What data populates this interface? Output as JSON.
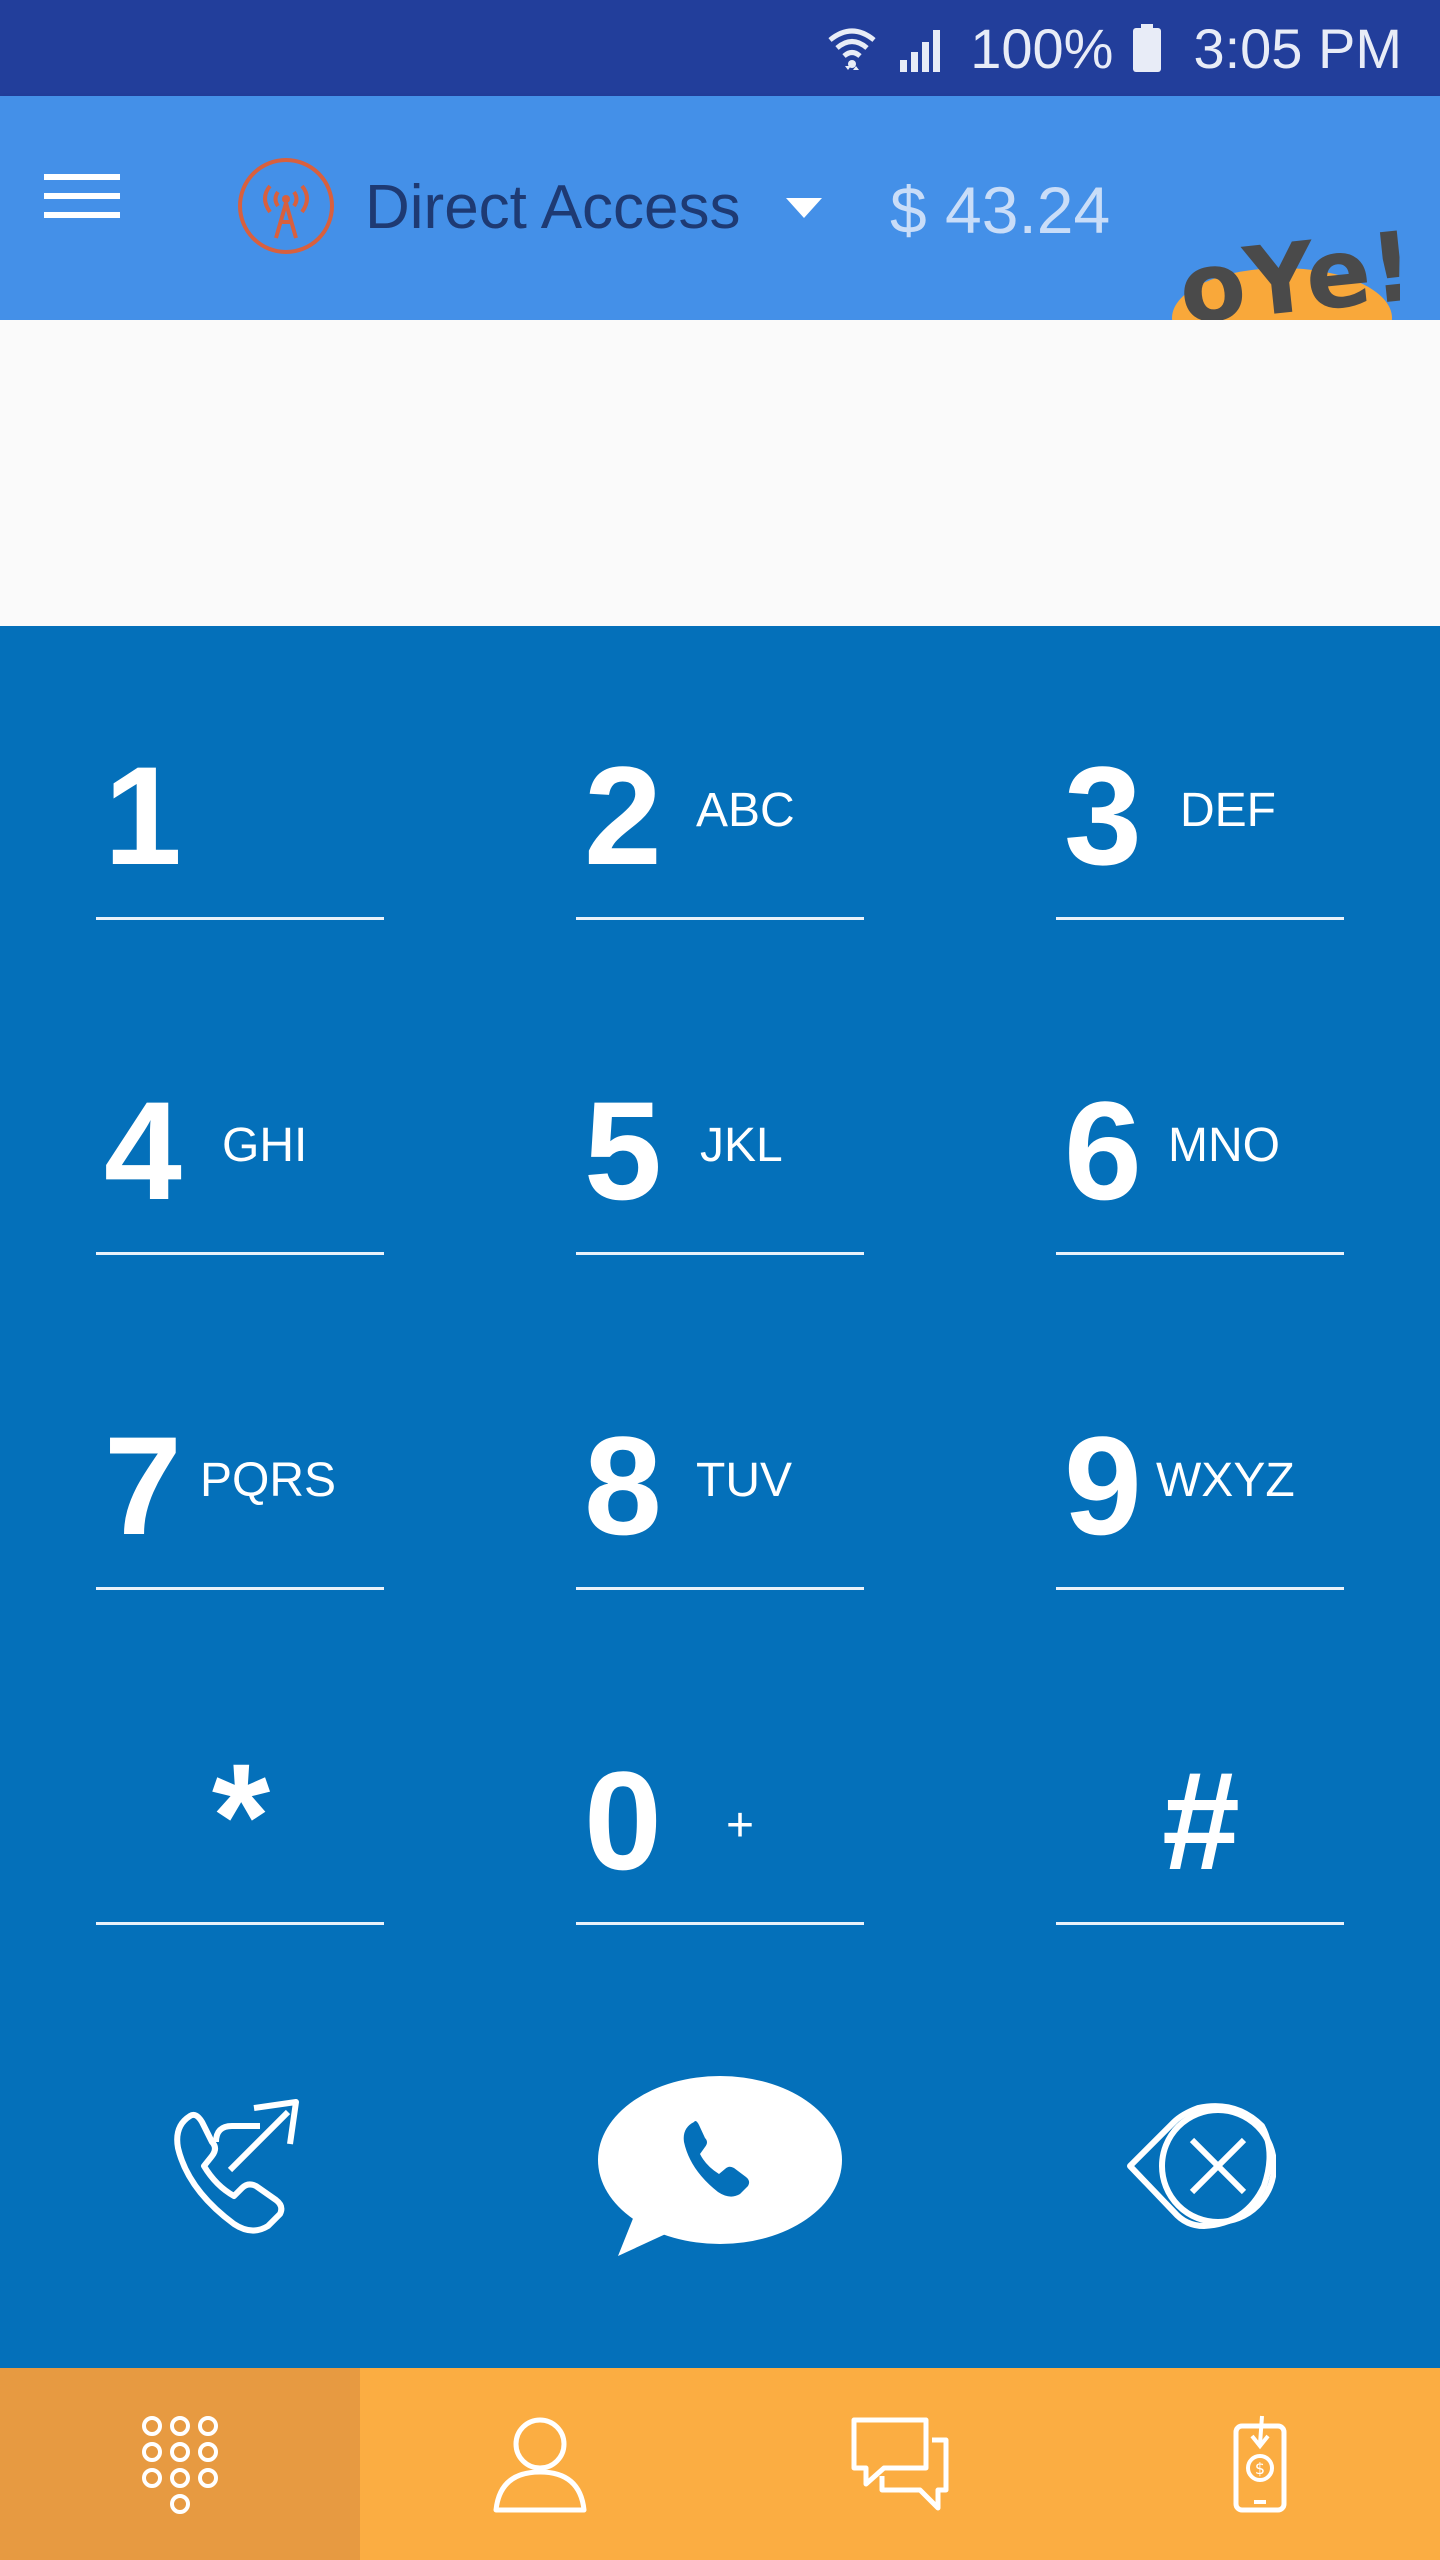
{
  "status_bar": {
    "battery": "100%",
    "time": "3:05 PM"
  },
  "header": {
    "account_name": "Direct Access",
    "balance": "$ 43.24",
    "logo_text": "OYe!"
  },
  "dialer": {
    "number": "",
    "keys": [
      {
        "digit": "1",
        "letters": ""
      },
      {
        "digit": "2",
        "letters": "ABC"
      },
      {
        "digit": "3",
        "letters": "DEF"
      },
      {
        "digit": "4",
        "letters": "GHI"
      },
      {
        "digit": "5",
        "letters": "JKL"
      },
      {
        "digit": "6",
        "letters": "MNO"
      },
      {
        "digit": "7",
        "letters": "PQRS"
      },
      {
        "digit": "8",
        "letters": "TUV"
      },
      {
        "digit": "9",
        "letters": "WXYZ"
      },
      {
        "digit": "*",
        "letters": ""
      },
      {
        "digit": "0",
        "letters": "+"
      },
      {
        "digit": "#",
        "letters": ""
      }
    ]
  },
  "icons": {
    "menu": "hamburger-icon",
    "account": "radio-tower-icon",
    "transfer_call": "phone-forward-icon",
    "call": "phone-bubble-icon",
    "backspace": "backspace-icon",
    "tab_keypad": "dialpad-icon",
    "tab_contacts": "person-icon",
    "tab_messages": "chat-icon",
    "tab_topup": "mobile-topup-icon"
  },
  "colors": {
    "status_bar": "#223E9B",
    "app_bar": "#4490E8",
    "keypad": "#0470BA",
    "bottom_nav": "#FBAD42",
    "bottom_nav_active": "#E79A41",
    "logo_accent": "#F9A83A"
  }
}
